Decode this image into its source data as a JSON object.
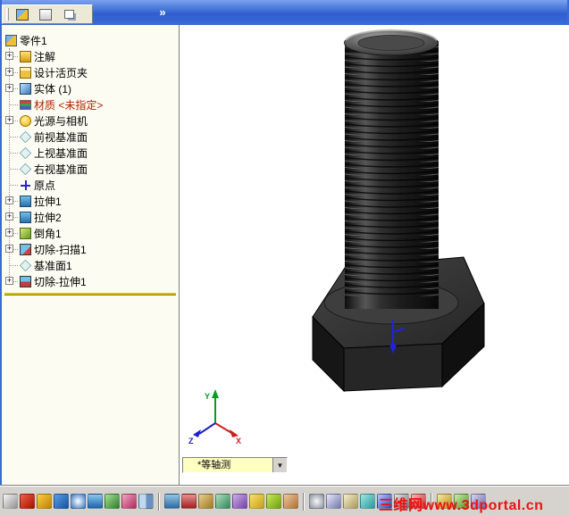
{
  "ui": {
    "plus": "+",
    "expand_chevron": "»",
    "dropdown_arrow": "▼"
  },
  "top_toolbar": {
    "buttons": [
      {
        "name": "new-document"
      },
      {
        "name": "open-document"
      },
      {
        "name": "toolbar-options"
      }
    ]
  },
  "tree": {
    "items": [
      {
        "label": "零件1",
        "icon": "part"
      },
      {
        "label": "注解",
        "icon": "annotations"
      },
      {
        "label": "设计活页夹",
        "icon": "design-binder"
      },
      {
        "label": "实体 (1)",
        "icon": "solid-bodies"
      },
      {
        "label": "材质 <未指定>",
        "icon": "material"
      },
      {
        "label": "光源与相机",
        "icon": "lights-cameras"
      },
      {
        "label": "前视基准面",
        "icon": "plane"
      },
      {
        "label": "上视基准面",
        "icon": "plane"
      },
      {
        "label": "右视基准面",
        "icon": "plane"
      },
      {
        "label": "原点",
        "icon": "origin"
      },
      {
        "label": "拉伸1",
        "icon": "extrude"
      },
      {
        "label": "拉伸2",
        "icon": "extrude"
      },
      {
        "label": "倒角1",
        "icon": "chamfer"
      },
      {
        "label": "切除-扫描1",
        "icon": "cut-sweep"
      },
      {
        "label": "基准面1",
        "icon": "plane"
      },
      {
        "label": "切除-拉伸1",
        "icon": "cut-extrude"
      }
    ]
  },
  "viewport": {
    "orientation": "*等轴测",
    "triad": {
      "x_label": "X",
      "y_label": "Y",
      "z_label": "Z",
      "x_color": "#cc2020",
      "y_color": "#00a020",
      "z_color": "#2020cc"
    }
  },
  "watermark": {
    "text": "三维网www.3dportal.cn",
    "color": "#ee1111"
  },
  "bottom_toolbar": {
    "icons": [
      {
        "name": "select-arrow-icon",
        "bg": "linear-gradient(135deg,#f8f8f8,#909090)"
      },
      {
        "name": "sketch-icon",
        "bg": "linear-gradient(135deg,#f06048,#a81000)"
      },
      {
        "name": "smart-dimension-icon",
        "bg": "linear-gradient(135deg,#f8d048,#c08000)"
      },
      {
        "name": "line-icon",
        "bg": "linear-gradient(135deg,#58a0e8,#1850a0)"
      },
      {
        "name": "circle-icon",
        "bg": "radial-gradient(circle,#ffffff,#3878c8)"
      },
      {
        "name": "arc-icon",
        "bg": "linear-gradient(180deg,#88c8f0,#2060a8)"
      },
      {
        "name": "rectangle-icon",
        "bg": "linear-gradient(135deg,#a8e098,#288028)"
      },
      {
        "name": "trim-icon",
        "bg": "linear-gradient(135deg,#f0a8c0,#b02860)"
      },
      {
        "name": "mirror-icon",
        "bg": "linear-gradient(90deg,#c0d8f0 50%,#6890c0 50%)"
      },
      {
        "name": "extrude-boss-icon",
        "bg": "linear-gradient(180deg,#90c8e8,#3068a0)"
      },
      {
        "name": "extrude-cut-icon",
        "bg": "linear-gradient(180deg,#e89090,#a02020)"
      },
      {
        "name": "revolve-icon",
        "bg": "linear-gradient(135deg,#e8d090,#a07820)"
      },
      {
        "name": "sweep-icon",
        "bg": "linear-gradient(135deg,#b0e0c0,#308858)"
      },
      {
        "name": "loft-icon",
        "bg": "linear-gradient(135deg,#d0b0e8,#7040a8)"
      },
      {
        "name": "fillet-icon",
        "bg": "linear-gradient(135deg,#f8e070,#c8a010)"
      },
      {
        "name": "chamfer-icon",
        "bg": "linear-gradient(135deg,#c8e858,#70a010)"
      },
      {
        "name": "shell-icon",
        "bg": "linear-gradient(135deg,#f0c8a0,#b07030)"
      },
      {
        "name": "zoom-fit-icon",
        "bg": "radial-gradient(circle,#f8f8f8,#8890a0)"
      },
      {
        "name": "zoom-area-icon",
        "bg": "linear-gradient(135deg,#e8e8f8,#7078b0)"
      },
      {
        "name": "pan-icon",
        "bg": "linear-gradient(135deg,#f8f0d0,#a89858)"
      },
      {
        "name": "rotate-view-icon",
        "bg": "linear-gradient(135deg,#a0e8e0,#2898a0)"
      },
      {
        "name": "shaded-icon",
        "bg": "linear-gradient(135deg,#b8c8f8,#3048c0)"
      },
      {
        "name": "wireframe-icon",
        "bg": "linear-gradient(135deg,#e8e8e8,#707070)"
      },
      {
        "name": "section-view-icon",
        "bg": "linear-gradient(135deg,#f8b8b8,#c03030)"
      },
      {
        "name": "measure-icon",
        "bg": "linear-gradient(135deg,#f8e8a0,#b89020)"
      },
      {
        "name": "mass-properties-icon",
        "bg": "linear-gradient(135deg,#c8f0a8,#589028)"
      },
      {
        "name": "options-icon",
        "bg": "linear-gradient(135deg,#d8d8f0,#6868a8)"
      }
    ]
  }
}
